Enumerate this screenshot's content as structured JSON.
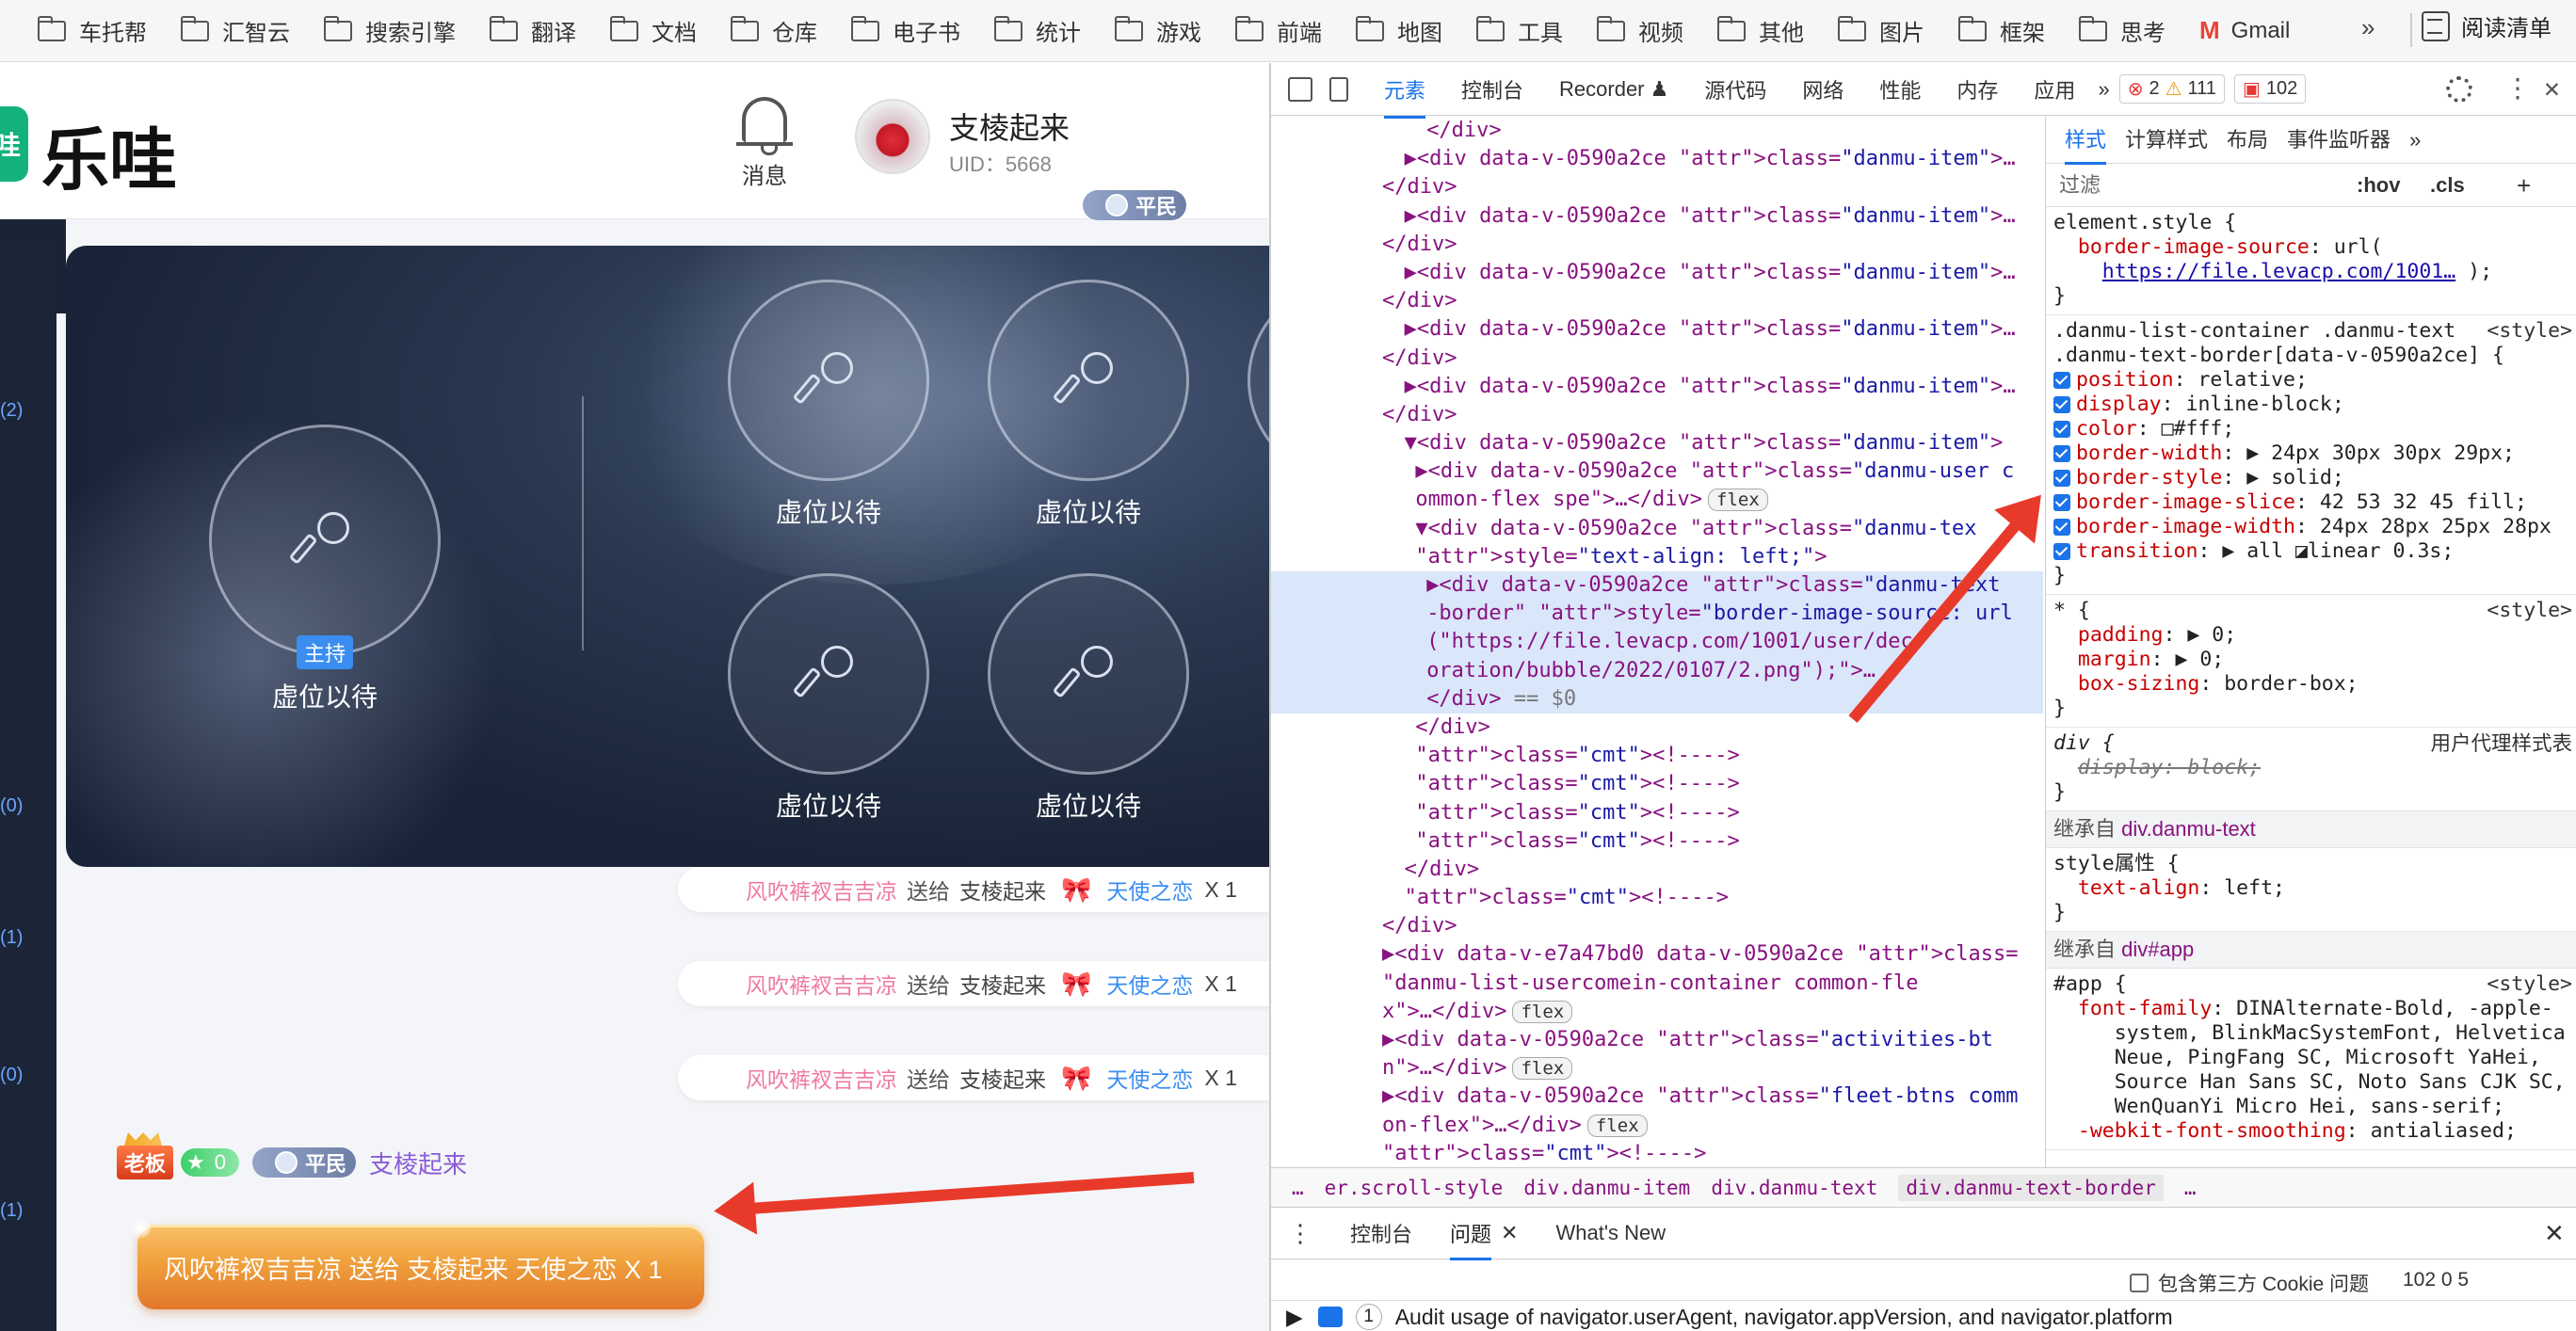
{
  "bookmarks": {
    "items": [
      "车托帮",
      "汇智云",
      "搜索引擎",
      "翻译",
      "文档",
      "仓库",
      "电子书",
      "统计",
      "游戏",
      "前端",
      "地图",
      "工具",
      "视频",
      "其他",
      "图片",
      "框架",
      "思考"
    ],
    "gmail": "Gmail",
    "more": "»",
    "reading_list": "阅读清单"
  },
  "app": {
    "logo_mark": "哇",
    "logo_text": "乐哇",
    "bell_label": "消息",
    "user_name": "支棱起来",
    "user_uid": "UID：5668",
    "rank": "平民"
  },
  "left_strip": [
    "(2)",
    "(0)",
    "(1)",
    "(0)",
    "(1)"
  ],
  "stage": {
    "host_badge": "主持",
    "host_label": "虚位以待",
    "seat_label": "虚位以待"
  },
  "gifts": [
    {
      "from": "风吹裤衩吉吉凉",
      "verb": "送给",
      "to": "支棱起来",
      "bow": "🎀",
      "gift": "天使之恋",
      "count": "X 1"
    },
    {
      "from": "风吹裤衩吉吉凉",
      "verb": "送给",
      "to": "支棱起来",
      "bow": "🎀",
      "gift": "天使之恋",
      "count": "X 1"
    },
    {
      "from": "风吹裤衩吉吉凉",
      "verb": "送给",
      "to": "支棱起来",
      "bow": "🎀",
      "gift": "天使之恋",
      "count": "X 1"
    }
  ],
  "danmu": {
    "boss_badge": "老板",
    "level": "0",
    "rank": "平民",
    "username": "支棱起来",
    "bubble_text": "风吹裤衩吉吉凉 送给 支棱起来 天使之恋 X 1"
  },
  "devtools": {
    "tabs": [
      "元素",
      "控制台",
      "Recorder ♟",
      "源代码",
      "网络",
      "性能",
      "内存",
      "应用"
    ],
    "more": "»",
    "errors": "2",
    "warnings": "111",
    "issues": "102",
    "styles_tabs": [
      "样式",
      "计算样式",
      "布局",
      "事件监听器"
    ],
    "filter_placeholder": "过滤",
    "hov": ":hov",
    "cls": ".cls",
    "elements_lines": [
      "</div>",
      "▶<div data-v-0590a2ce class=\"danmu-item\">…",
      "</div>",
      "▶<div data-v-0590a2ce class=\"danmu-item\">…",
      "</div>",
      "▶<div data-v-0590a2ce class=\"danmu-item\">…",
      "</div>",
      "▶<div data-v-0590a2ce class=\"danmu-item\">…",
      "</div>",
      "▶<div data-v-0590a2ce class=\"danmu-item\">…",
      "</div>",
      "▼<div data-v-0590a2ce class=\"danmu-item\">",
      "▶<div data-v-0590a2ce class=\"danmu-user c",
      "ommon-flex spe\">…</div>",
      "▼<div data-v-0590a2ce class=\"danmu-tex",
      "style=\"text-align: left;\">",
      "▶<div data-v-0590a2ce class=\"danmu-text",
      "-border\" style=\"border-image-source: url",
      "(\"https://file.levacp.com/1001/user/dec",
      "oration/bubble/2022/0107/2.png\");\">…",
      "</div> == $0",
      "</div>",
      "<!---->",
      "<!---->",
      "<!---->",
      "<!---->",
      "</div>",
      "<!---->",
      "</div>",
      "▶<div data-v-e7a47bd0 data-v-0590a2ce class=",
      "\"danmu-list-usercomein-container common-fle",
      "x\">…</div>",
      "▶<div data-v-0590a2ce class=\"activities-bt",
      "n\">…</div>",
      "▶<div data-v-0590a2ce class=\"fleet-btns comm",
      "on-flex\">…</div>",
      "<!---->"
    ],
    "flex_badge": "flex",
    "eq": "== $0",
    "breadcrumbs": [
      "…",
      "er.scroll-style",
      "div.danmu-item",
      "div.danmu-text",
      "div.danmu-text-border",
      "…"
    ],
    "drawer_tabs": [
      "控制台",
      "问题",
      "What's New"
    ],
    "third_party": "包含第三方 Cookie 问题",
    "issue_counts": "102  0  5",
    "issue_line": "Audit usage of navigator.userAgent, navigator.appVersion, and navigator.platform",
    "issue_num": "1"
  },
  "styles": {
    "element_style": "element.style {",
    "bis_prop": "border-image-source",
    "bis_val": "url(",
    "bis_link": "https://file.levacp.com/1001…",
    "bis_end": ");",
    "close": "}",
    "rule2_sel1": ".danmu-list-container .danmu-text",
    "rule2_sel2": ".danmu-text-border[data-v-0590a2ce] {",
    "src_style": "<style>",
    "decls": [
      {
        "p": "position",
        "v": "relative;"
      },
      {
        "p": "display",
        "v": "inline-block;"
      },
      {
        "p": "color",
        "v": "□#fff;"
      },
      {
        "p": "border-width",
        "v": "▶ 24px 30px 30px 29px;"
      },
      {
        "p": "border-style",
        "v": "▶ solid;"
      },
      {
        "p": "border-image-slice",
        "v": "42 53 32 45 fill;"
      },
      {
        "p": "border-image-width",
        "v": "24px 28px 25px 28px"
      },
      {
        "p": "transition",
        "v": "▶ all ◪linear 0.3s;"
      }
    ],
    "star_sel": "* {",
    "star_decls": [
      {
        "p": "padding",
        "v": "▶ 0;"
      },
      {
        "p": "margin",
        "v": "▶ 0;"
      },
      {
        "p": "box-sizing",
        "v": "border-box;"
      }
    ],
    "div_sel": "div {",
    "ua": "用户代理样式表",
    "div_decl": "display: block;",
    "inherit1": "继承自",
    "inherit1_sel": "div.danmu-text",
    "style_attr": "style属性 {",
    "ta": {
      "p": "text-align",
      "v": "left;"
    },
    "inherit2": "继承自",
    "inherit2_sel": "div#app",
    "app_sel": "#app {",
    "ff_prop": "font-family",
    "ff_val1": "DINAlternate-Bold, -apple-",
    "ff_val2": "system, BlinkMacSystemFont, Helvetica",
    "ff_val3": "Neue, PingFang SC, Microsoft YaHei,",
    "ff_val4": "Source Han Sans SC, Noto Sans CJK SC,",
    "ff_val5": "WenQuanYi Micro Hei, sans-serif;",
    "wfs": "-webkit-font-smoothing",
    "wfs_val": "antialiased;"
  }
}
